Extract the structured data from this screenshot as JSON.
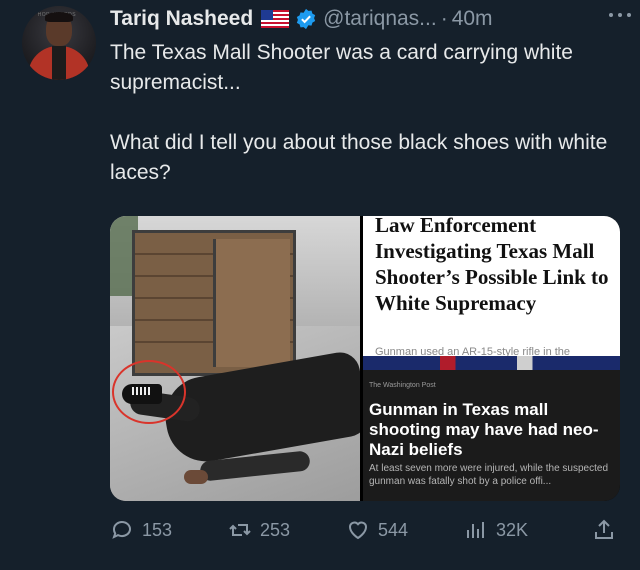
{
  "author": {
    "name": "Tariq Nasheed",
    "handle": "@tariqnas...",
    "separator": "·",
    "time": "40m",
    "avatar_badge": "HIP HOP AWARDS"
  },
  "tweet": {
    "text": "The Texas Mall Shooter was a card carrying white supremacist...\n\nWhat did I tell you about those black shoes with white laces?"
  },
  "media": {
    "article1": {
      "headline": "Law Enforcement Investigating Texas Mall Shooter’s Possible Link to White Supremacy",
      "subline": "Gunman used an AR-15-style rifle in the"
    },
    "article2": {
      "source": "The Washington Post",
      "headline": "Gunman in Texas mall shooting may have had neo-Nazi beliefs",
      "summary": "At least seven more were injured, while the suspected gunman was fatally shot by a police offi..."
    }
  },
  "actions": {
    "replies": "153",
    "retweets": "253",
    "likes": "544",
    "views": "32K"
  },
  "colors": {
    "background": "#15202b",
    "text": "#e7e9ea",
    "muted": "#8b98a5",
    "verified": "#1d9bf0"
  },
  "icons": [
    "more-icon",
    "flag-icon",
    "verified-icon",
    "reply-icon",
    "retweet-icon",
    "like-icon",
    "views-icon",
    "share-icon"
  ]
}
